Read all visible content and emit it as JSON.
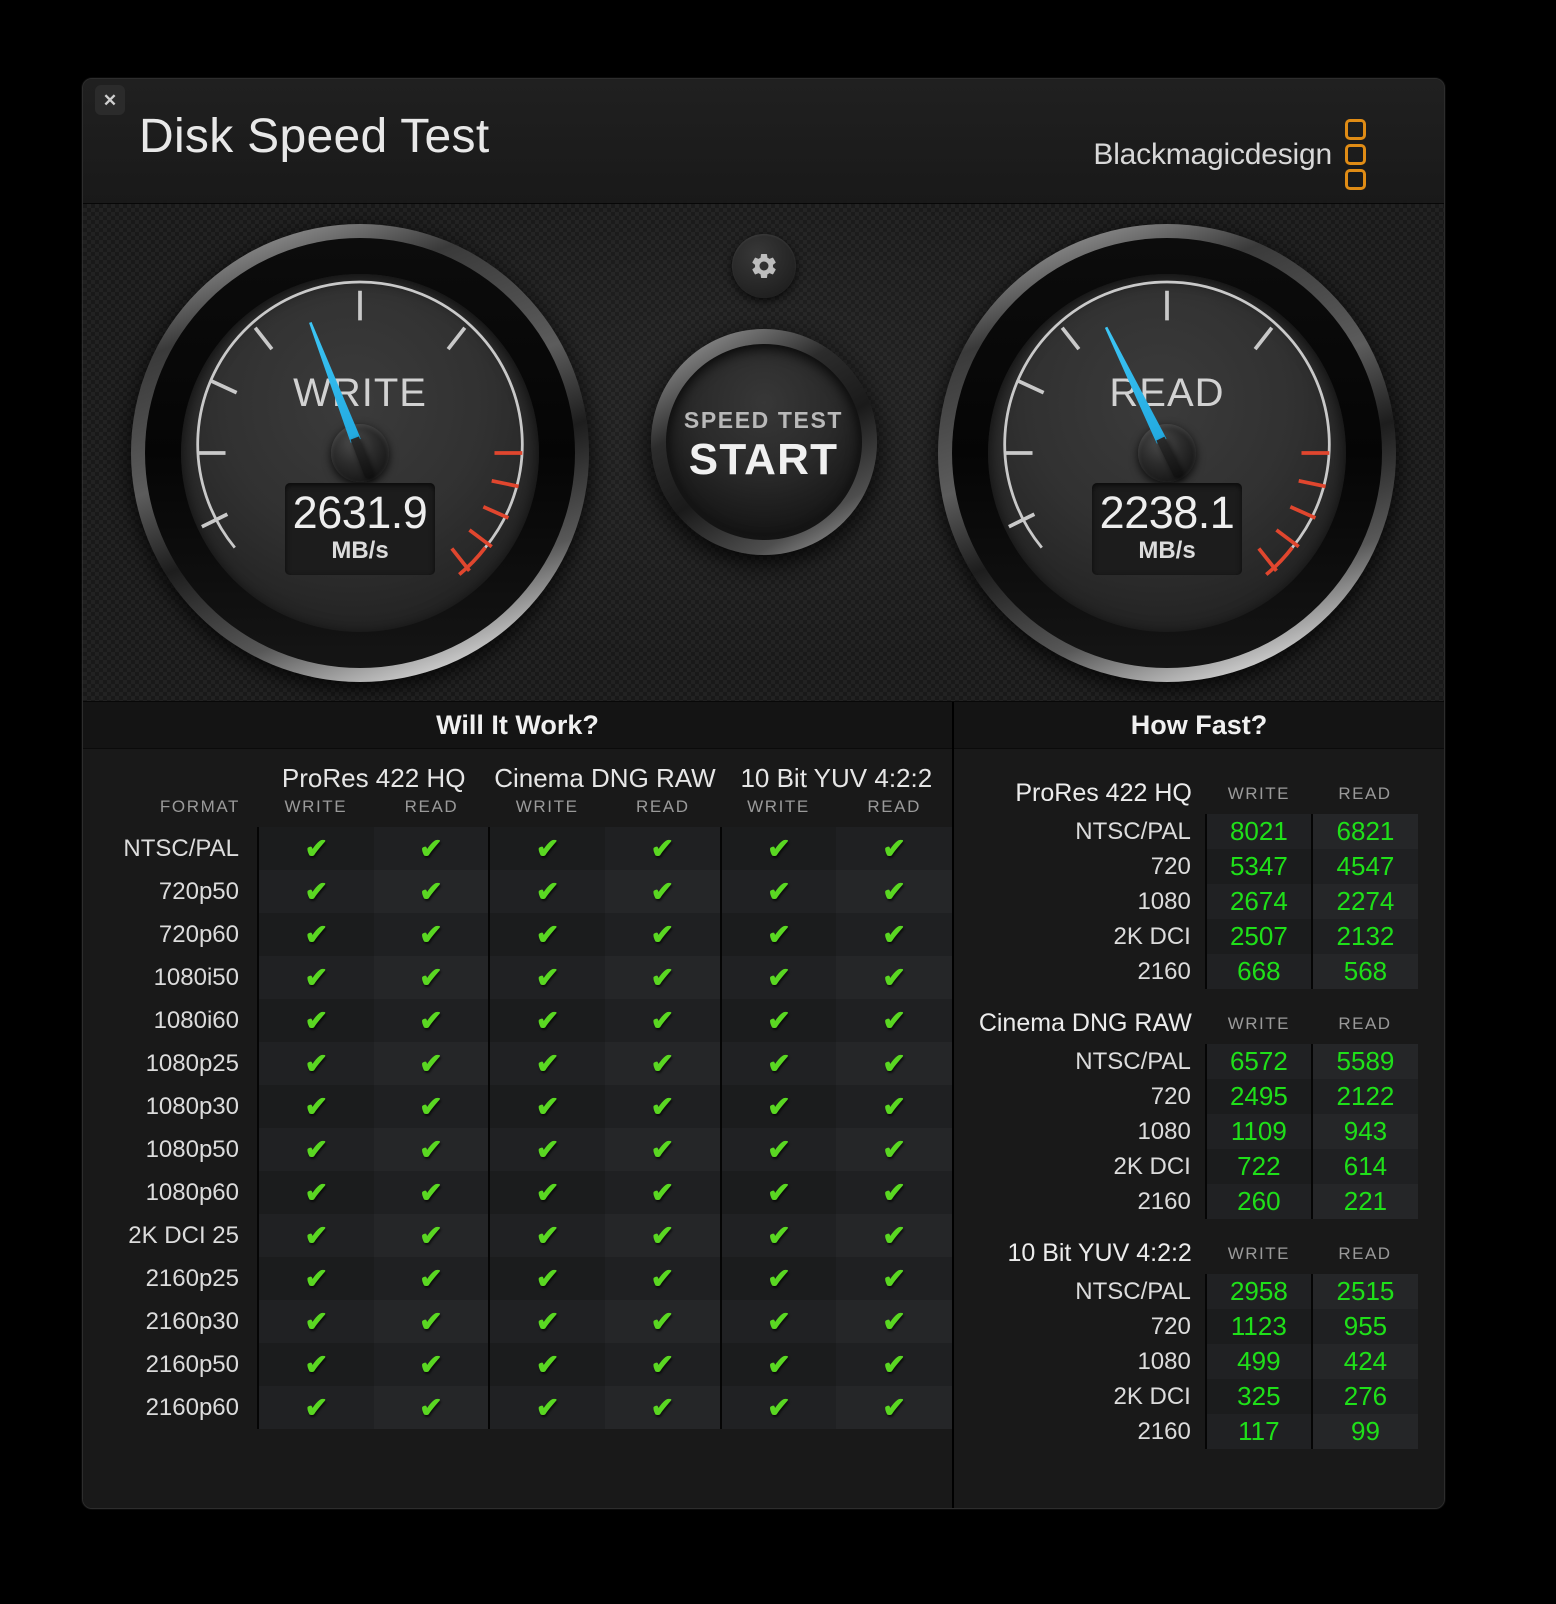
{
  "window": {
    "title": "Disk Speed Test",
    "close_label": "✕",
    "brand_text": "Blackmagicdesign"
  },
  "colors": {
    "needle_blue": "#29ABE2",
    "danger_red": "#E0462E",
    "check_green": "#5AD722",
    "value_green": "#1FE019",
    "brand_orange": "#E08C15"
  },
  "gauges": [
    {
      "id": "write",
      "label": "WRITE",
      "value": "2631.9",
      "unit": "MB/s",
      "needle_angle": -21
    },
    {
      "id": "read",
      "label": "READ",
      "value": "2238.1",
      "unit": "MB/s",
      "needle_angle": -26
    }
  ],
  "center": {
    "gear_icon": "gear-icon",
    "start_sub_label": "SPEED TEST",
    "start_main_label": "START"
  },
  "will_it_work": {
    "title": "Will It Work?",
    "format_header": "FORMAT",
    "codec_groups": [
      "ProRes 422 HQ",
      "Cinema DNG RAW",
      "10 Bit YUV 4:2:2"
    ],
    "sub_headers": [
      "WRITE",
      "READ"
    ],
    "check_glyph": "✔",
    "rows": [
      {
        "format": "NTSC/PAL",
        "cells": [
          true,
          true,
          true,
          true,
          true,
          true
        ]
      },
      {
        "format": "720p50",
        "cells": [
          true,
          true,
          true,
          true,
          true,
          true
        ]
      },
      {
        "format": "720p60",
        "cells": [
          true,
          true,
          true,
          true,
          true,
          true
        ]
      },
      {
        "format": "1080i50",
        "cells": [
          true,
          true,
          true,
          true,
          true,
          true
        ]
      },
      {
        "format": "1080i60",
        "cells": [
          true,
          true,
          true,
          true,
          true,
          true
        ]
      },
      {
        "format": "1080p25",
        "cells": [
          true,
          true,
          true,
          true,
          true,
          true
        ]
      },
      {
        "format": "1080p30",
        "cells": [
          true,
          true,
          true,
          true,
          true,
          true
        ]
      },
      {
        "format": "1080p50",
        "cells": [
          true,
          true,
          true,
          true,
          true,
          true
        ]
      },
      {
        "format": "1080p60",
        "cells": [
          true,
          true,
          true,
          true,
          true,
          true
        ]
      },
      {
        "format": "2K DCI 25",
        "cells": [
          true,
          true,
          true,
          true,
          true,
          true
        ]
      },
      {
        "format": "2160p25",
        "cells": [
          true,
          true,
          true,
          true,
          true,
          true
        ]
      },
      {
        "format": "2160p30",
        "cells": [
          true,
          true,
          true,
          true,
          true,
          true
        ]
      },
      {
        "format": "2160p50",
        "cells": [
          true,
          true,
          true,
          true,
          true,
          true
        ]
      },
      {
        "format": "2160p60",
        "cells": [
          true,
          true,
          true,
          true,
          true,
          true
        ]
      }
    ]
  },
  "how_fast": {
    "title": "How Fast?",
    "col_write": "WRITE",
    "col_read": "READ",
    "sections": [
      {
        "name": "ProRes 422 HQ",
        "rows": [
          {
            "name": "NTSC/PAL",
            "write": "8021",
            "read": "6821"
          },
          {
            "name": "720",
            "write": "5347",
            "read": "4547"
          },
          {
            "name": "1080",
            "write": "2674",
            "read": "2274"
          },
          {
            "name": "2K DCI",
            "write": "2507",
            "read": "2132"
          },
          {
            "name": "2160",
            "write": "668",
            "read": "568"
          }
        ]
      },
      {
        "name": "Cinema DNG RAW",
        "rows": [
          {
            "name": "NTSC/PAL",
            "write": "6572",
            "read": "5589"
          },
          {
            "name": "720",
            "write": "2495",
            "read": "2122"
          },
          {
            "name": "1080",
            "write": "1109",
            "read": "943"
          },
          {
            "name": "2K DCI",
            "write": "722",
            "read": "614"
          },
          {
            "name": "2160",
            "write": "260",
            "read": "221"
          }
        ]
      },
      {
        "name": "10 Bit YUV 4:2:2",
        "rows": [
          {
            "name": "NTSC/PAL",
            "write": "2958",
            "read": "2515"
          },
          {
            "name": "720",
            "write": "1123",
            "read": "955"
          },
          {
            "name": "1080",
            "write": "499",
            "read": "424"
          },
          {
            "name": "2K DCI",
            "write": "325",
            "read": "276"
          },
          {
            "name": "2160",
            "write": "117",
            "read": "99"
          }
        ]
      }
    ]
  }
}
